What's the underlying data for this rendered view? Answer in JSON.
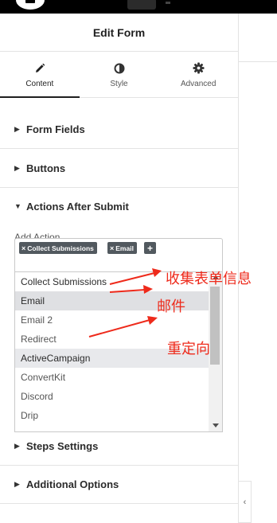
{
  "header": {
    "title": "Edit Form"
  },
  "tabs": [
    {
      "label": "Content",
      "icon": "pencil-icon",
      "active": true
    },
    {
      "label": "Style",
      "icon": "half-circle-icon",
      "active": false
    },
    {
      "label": "Advanced",
      "icon": "gear-icon",
      "active": false
    }
  ],
  "sections": {
    "form_fields": "Form Fields",
    "buttons": "Buttons",
    "actions_after_submit": "Actions After Submit",
    "steps_settings": "Steps Settings",
    "additional_options": "Additional Options"
  },
  "add_action": {
    "label": "Add Action",
    "selected_tags": [
      "Collect Submissions",
      "Email"
    ],
    "tag_remove_glyph": "×",
    "add_glyph": "+"
  },
  "dropdown": {
    "options": [
      "Collect Submissions",
      "Email",
      "Email 2",
      "Redirect",
      "ActiveCampaign",
      "ConvertKit",
      "Discord",
      "Drip"
    ],
    "highlighted_option": "Email"
  },
  "annotations": {
    "collect_info": "收集表单信息",
    "mail": "邮件",
    "redirect": "重定向"
  },
  "colors": {
    "annotation": "#ee2a1b",
    "tag_bg": "#52595f",
    "highlight_bg": "#e8e9ec"
  },
  "collapse_glyph": "‹"
}
